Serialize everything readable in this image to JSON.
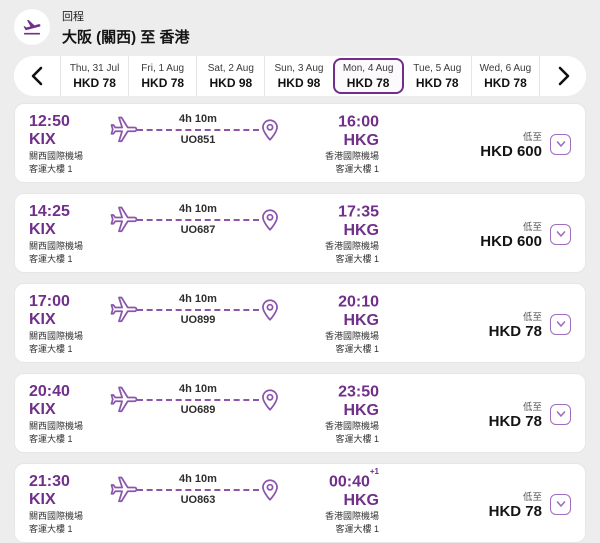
{
  "header": {
    "trip_type_label": "回程",
    "route_title": "大阪 (關西) 至 香港"
  },
  "date_bar": {
    "dates": [
      {
        "label": "Thu, 31 Jul",
        "price": "HKD 78",
        "selected": false
      },
      {
        "label": "Fri, 1 Aug",
        "price": "HKD 78",
        "selected": false
      },
      {
        "label": "Sat, 2 Aug",
        "price": "HKD 98",
        "selected": false
      },
      {
        "label": "Sun, 3 Aug",
        "price": "HKD 98",
        "selected": false
      },
      {
        "label": "Mon, 4 Aug",
        "price": "HKD 78",
        "selected": true
      },
      {
        "label": "Tue, 5 Aug",
        "price": "HKD 78",
        "selected": false
      },
      {
        "label": "Wed, 6 Aug",
        "price": "HKD 78",
        "selected": false
      }
    ]
  },
  "flights": [
    {
      "dep_time": "12:50",
      "dep_code": "KIX",
      "dep_airport": "關西國際機場",
      "dep_terminal": "客運大樓 1",
      "duration": "4h 10m",
      "flight_no": "UO851",
      "arr_time": "16:00",
      "arr_day_offset": "",
      "arr_code": "HKG",
      "arr_airport": "香港國際機場",
      "arr_terminal": "客運大樓 1",
      "price_prefix": "低至",
      "price": "HKD 600"
    },
    {
      "dep_time": "14:25",
      "dep_code": "KIX",
      "dep_airport": "關西國際機場",
      "dep_terminal": "客運大樓 1",
      "duration": "4h 10m",
      "flight_no": "UO687",
      "arr_time": "17:35",
      "arr_day_offset": "",
      "arr_code": "HKG",
      "arr_airport": "香港國際機場",
      "arr_terminal": "客運大樓 1",
      "price_prefix": "低至",
      "price": "HKD 600"
    },
    {
      "dep_time": "17:00",
      "dep_code": "KIX",
      "dep_airport": "關西國際機場",
      "dep_terminal": "客運大樓 1",
      "duration": "4h 10m",
      "flight_no": "UO899",
      "arr_time": "20:10",
      "arr_day_offset": "",
      "arr_code": "HKG",
      "arr_airport": "香港國際機場",
      "arr_terminal": "客運大樓 1",
      "price_prefix": "低至",
      "price": "HKD 78"
    },
    {
      "dep_time": "20:40",
      "dep_code": "KIX",
      "dep_airport": "關西國際機場",
      "dep_terminal": "客運大樓 1",
      "duration": "4h 10m",
      "flight_no": "UO689",
      "arr_time": "23:50",
      "arr_day_offset": "",
      "arr_code": "HKG",
      "arr_airport": "香港國際機場",
      "arr_terminal": "客運大樓 1",
      "price_prefix": "低至",
      "price": "HKD 78"
    },
    {
      "dep_time": "21:30",
      "dep_code": "KIX",
      "dep_airport": "關西國際機場",
      "dep_terminal": "客運大樓 1",
      "duration": "4h 10m",
      "flight_no": "UO863",
      "arr_time": "00:40",
      "arr_day_offset": "+1",
      "arr_code": "HKG",
      "arr_airport": "香港國際機場",
      "arr_terminal": "客運大樓 1",
      "price_prefix": "低至",
      "price": "HKD 78"
    }
  ],
  "colors": {
    "brand_purple": "#702f8a",
    "icon_purple": "#8a55ab",
    "page_background": "#ededed",
    "card_background": "#ffffff"
  }
}
